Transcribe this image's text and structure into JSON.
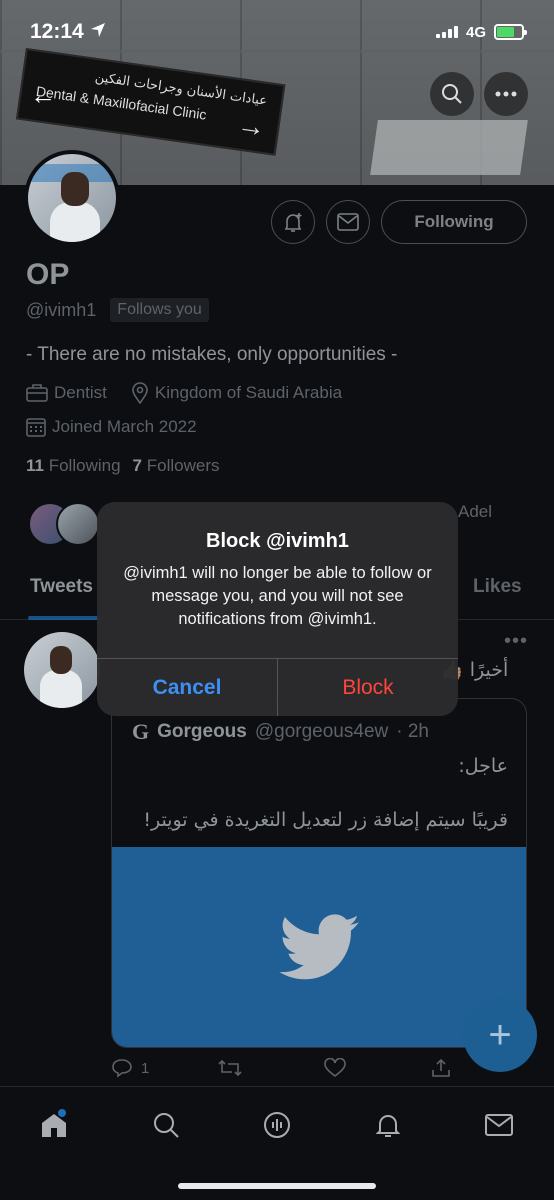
{
  "status_bar": {
    "time": "12:14",
    "network": "4G"
  },
  "banner": {
    "sign_arabic": "عيادات الأسنان وجراحات الفكين",
    "sign_english": "Dental & Maxillofacial Clinic"
  },
  "profile": {
    "name": "OP",
    "handle": "@ivimh1",
    "follows_you": "Follows you",
    "following_button": "Following",
    "bio": "- There are no mistakes, only opportunities -",
    "profession": "Dentist",
    "location": "Kingdom of Saudi Arabia",
    "joined": "Joined March 2022",
    "following_count": "11",
    "following_label": "Following",
    "followers_count": "7",
    "followers_label": "Followers",
    "followed_by_partial": "Adel"
  },
  "tabs": {
    "tweets": "Tweets",
    "likes": "Likes"
  },
  "tweet": {
    "text": "أخيرًا 👍🏽",
    "quote": {
      "name": "Gorgeous",
      "handle": "@gorgeous4ew",
      "time": "· 2h",
      "line1": "عاجل:",
      "line2": "قريبًا سيتم إضافة زر لتعديل التغريدة في تويتر!"
    },
    "reply_count": "1"
  },
  "alert": {
    "title": "Block @ivimh1",
    "message": "@ivimh1 will no longer be able to follow or message you, and you will not see notifications from @ivimh1.",
    "cancel": "Cancel",
    "block": "Block"
  },
  "colors": {
    "accent": "#1d9bf0",
    "destructive": "#ff453a",
    "ios_blue": "#3d8ff5"
  }
}
